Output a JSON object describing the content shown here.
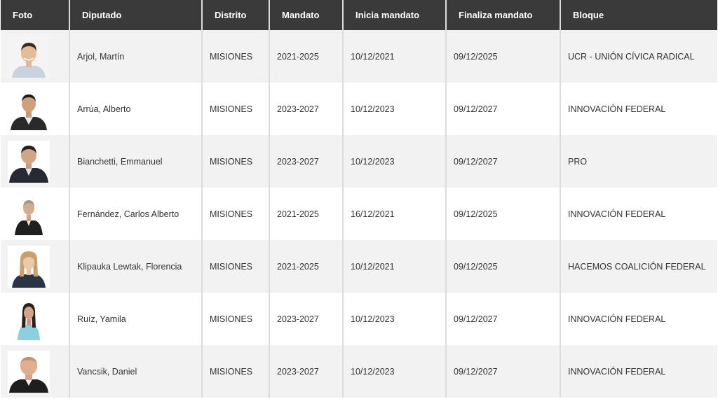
{
  "headers": {
    "foto": "Foto",
    "diputado": "Diputado",
    "distrito": "Distrito",
    "mandato": "Mandato",
    "inicia": "Inicia mandato",
    "finaliza": "Finaliza mandato",
    "bloque": "Bloque"
  },
  "rows": [
    {
      "nombre": "Arjol, Martín",
      "distrito": "MISIONES",
      "mandato": "2021-2025",
      "inicia": "10/12/2021",
      "finaliza": "09/12/2025",
      "bloque": "UCR - UNIÓN CÍVICA RADICAL"
    },
    {
      "nombre": "Arrúa, Alberto",
      "distrito": "MISIONES",
      "mandato": "2023-2027",
      "inicia": "10/12/2023",
      "finaliza": "09/12/2027",
      "bloque": "INNOVACIÓN FEDERAL"
    },
    {
      "nombre": "Bianchetti, Emmanuel",
      "distrito": "MISIONES",
      "mandato": "2023-2027",
      "inicia": "10/12/2023",
      "finaliza": "09/12/2027",
      "bloque": "PRO"
    },
    {
      "nombre": "Fernández, Carlos Alberto",
      "distrito": "MISIONES",
      "mandato": "2021-2025",
      "inicia": "16/12/2021",
      "finaliza": "09/12/2025",
      "bloque": "INNOVACIÓN FEDERAL"
    },
    {
      "nombre": "Klipauka Lewtak, Florencia",
      "distrito": "MISIONES",
      "mandato": "2021-2025",
      "inicia": "10/12/2021",
      "finaliza": "09/12/2025",
      "bloque": "HACEMOS COALICIÓN FEDERAL"
    },
    {
      "nombre": "Ruíz, Yamila",
      "distrito": "MISIONES",
      "mandato": "2023-2027",
      "inicia": "10/12/2023",
      "finaliza": "09/12/2027",
      "bloque": "INNOVACIÓN FEDERAL"
    },
    {
      "nombre": "Vancsik, Daniel",
      "distrito": "MISIONES",
      "mandato": "2023-2027",
      "inicia": "10/12/2023",
      "finaliza": "09/12/2027",
      "bloque": "INNOVACIÓN FEDERAL"
    }
  ],
  "colors": {
    "header_bg": "#3a3a3a",
    "header_text": "#ffffff",
    "row_odd": "#f2f2f2",
    "row_even": "#ffffff"
  }
}
